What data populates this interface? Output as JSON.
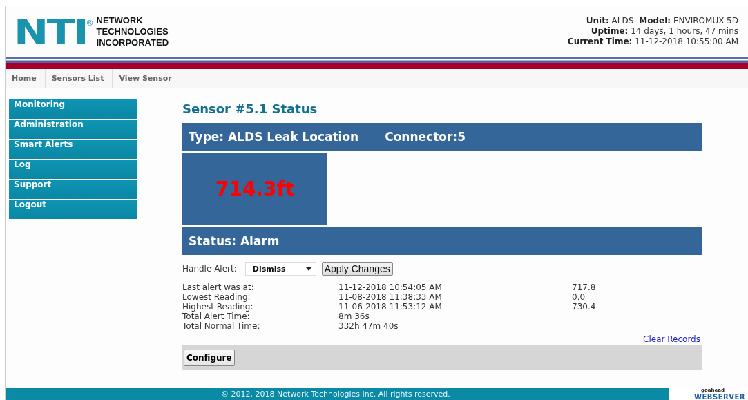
{
  "header": {
    "logo": {
      "mark": "NTI",
      "registered": "®",
      "lines": [
        "NETWORK",
        "TECHNOLOGIES",
        "INCORPORATED"
      ]
    },
    "info_lines": [
      [
        {
          "label": "Unit:",
          "value": "ALDS"
        },
        {
          "label": "Model:",
          "value": "ENVIROMUX-5D"
        }
      ],
      [
        {
          "label": "Uptime:",
          "value": "14 days, 1 hours, 47 mins"
        }
      ],
      [
        {
          "label": "Current Time:",
          "value": "11-12-2018 10:55:00 AM"
        }
      ]
    ]
  },
  "breadcrumb": [
    "Home",
    "Sensors List",
    "View Sensor"
  ],
  "sidebar": {
    "items": [
      "Monitoring",
      "Administration",
      "Smart Alerts",
      "Log",
      "Support",
      "Logout"
    ]
  },
  "sensor": {
    "title": "Sensor #5.1 Status",
    "type": "Type: ALDS Leak Location",
    "connector": "Connector:5",
    "reading": "714.3ft",
    "status": "Status: Alarm",
    "handle_alert": {
      "label": "Handle Alert:",
      "value": "Dismiss",
      "button": "Apply Changes"
    },
    "records": [
      {
        "label": "Last alert was at:",
        "time": "11-12-2018 10:54:05 AM",
        "value": "717.8"
      },
      {
        "label": "Lowest Reading:",
        "time": "11-08-2018 11:38:33 AM",
        "value": "0.0"
      },
      {
        "label": "Highest Reading:",
        "time": "11-06-2018 11:53:12 AM",
        "value": "730.4"
      },
      {
        "label": "Total Alert Time:",
        "time": "8m 36s"
      },
      {
        "label": "Total Normal Time:",
        "time": "332h 47m 40s"
      }
    ],
    "clear_link": "Clear Records",
    "configure_button": "Configure"
  },
  "footer": {
    "copyright": "© 2012, 2018 Network Technologies Inc. All rights reserved.",
    "badge": {
      "top": "goahead",
      "main": "WEBSERVER"
    }
  }
}
